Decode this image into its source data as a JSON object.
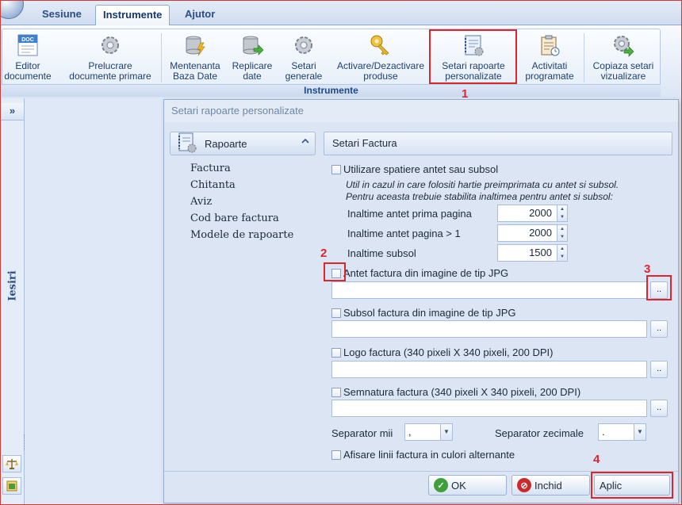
{
  "tabs": [
    {
      "label": "Sesiune"
    },
    {
      "label": "Instrumente",
      "active": true
    },
    {
      "label": "Ajutor"
    }
  ],
  "ribbon": {
    "group_label": "Instrumente",
    "buttons": [
      {
        "label": "Editor\ndocumente",
        "icon": "doc-icon"
      },
      {
        "label": "Prelucrare\ndocumente primare",
        "icon": "gear-icon"
      },
      {
        "label": "Mentenanta\nBaza Date",
        "icon": "database-icon"
      },
      {
        "label": "Replicare\ndate",
        "icon": "database-arrow-icon"
      },
      {
        "label": "Setari\ngenerale",
        "icon": "gear-icon"
      },
      {
        "label": "Activare/Dezactivare\nproduse",
        "icon": "key-icon"
      },
      {
        "label": "Setari rapoarte\npersonalizate",
        "icon": "notebook-gear-icon"
      },
      {
        "label": "Activitati\nprogramate",
        "icon": "clipboard-icon"
      },
      {
        "label": "Copiaza setari\nvizualizare",
        "icon": "gear-arrow-icon"
      }
    ]
  },
  "side": {
    "expand_label": "»",
    "vertical_label": "Iesiri"
  },
  "dialog": {
    "title": "Setari rapoarte personalizate",
    "nav": {
      "header": "Rapoarte",
      "items": [
        "Factura",
        "Chitanta",
        "Aviz",
        "Cod bare factura",
        "Modele de rapoarte"
      ]
    },
    "section_title": "Setari Factura",
    "header_option": {
      "label": "Utilizare spatiere antet sau subsol",
      "checked": false,
      "note_line1": "Util in cazul in care folositi hartie preimprimata cu antet si subsol.",
      "note_line2": "Pentru aceasta trebuie stabilita inaltimea pentru antet si subsol:"
    },
    "heights": [
      {
        "label": "Inaltime antet prima pagina",
        "value": "2000"
      },
      {
        "label": "Inaltime antet pagina > 1",
        "value": "2000"
      },
      {
        "label": "Inaltime subsol",
        "value": "1500"
      }
    ],
    "images": [
      {
        "label": "Antet factura din imagine de tip JPG",
        "checked": false,
        "value": ""
      },
      {
        "label": "Subsol factura din imagine de tip JPG",
        "checked": false,
        "value": ""
      },
      {
        "label": "Logo factura (340 pixeli X 340 pixeli, 200 DPI)",
        "checked": false,
        "value": ""
      },
      {
        "label": "Semnatura factura (340 pixeli X 340 pixeli, 200 DPI)",
        "checked": false,
        "value": ""
      }
    ],
    "browse_label": "..",
    "thousands_sep": {
      "label": "Separator mii",
      "value": ","
    },
    "decimal_sep": {
      "label": "Separator zecimale",
      "value": "."
    },
    "alt_colors": {
      "label": "Afisare linii factura in culori alternante",
      "checked": false
    },
    "buttons": {
      "ok": "OK",
      "cancel": "Inchid",
      "apply": "Aplic"
    }
  },
  "annotations": [
    "1",
    "2",
    "3",
    "4"
  ],
  "colors": {
    "annotation": "#e0242c",
    "accent": "#2a4f86"
  }
}
